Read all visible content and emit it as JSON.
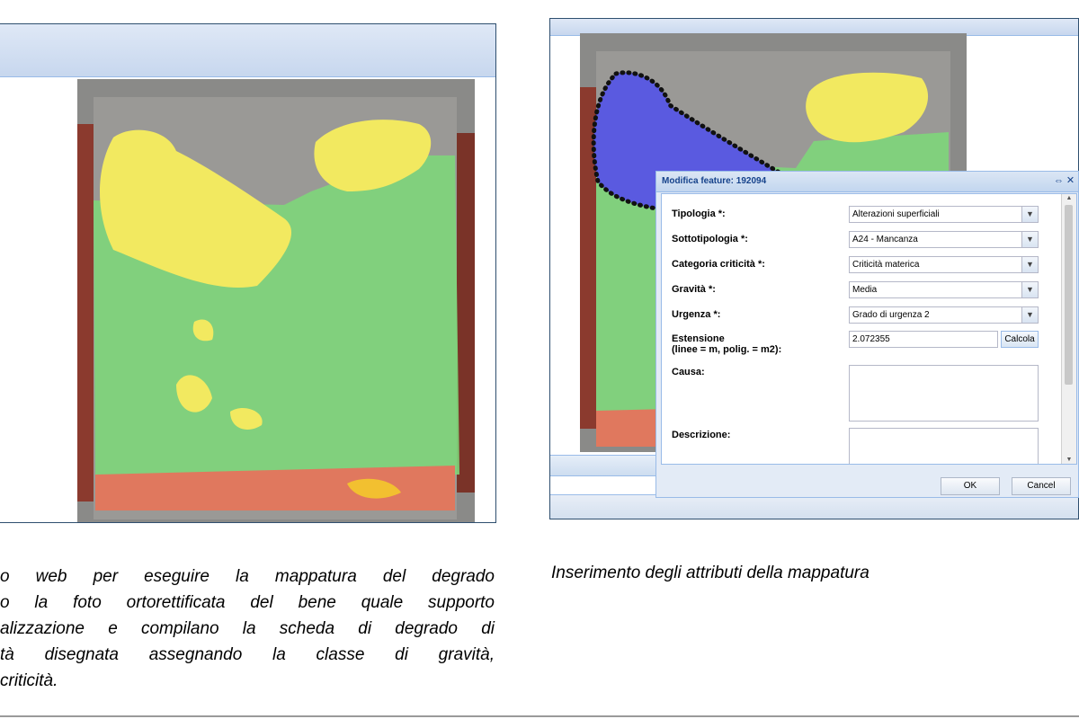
{
  "dialog": {
    "title": "Modifica feature: 192094",
    "tools": {
      "pin": "⇔",
      "close": "✕"
    },
    "fields": {
      "tipologia": {
        "label": "Tipologia *:",
        "value": "Alterazioni superficiali"
      },
      "sottotipologia": {
        "label": "Sottotipologia *:",
        "value": "A24 - Mancanza"
      },
      "categoria": {
        "label": "Categoria criticità *:",
        "value": "Criticità materica"
      },
      "gravita": {
        "label": "Gravità *:",
        "value": "Media"
      },
      "urgenza": {
        "label": "Urgenza *:",
        "value": "Grado di urgenza 2"
      },
      "estensione": {
        "label_line1": "Estensione",
        "label_line2": "(linee = m, polig. = m2):",
        "value": "2.072355",
        "calc_label": "Calcola"
      },
      "causa": {
        "label": "Causa:",
        "value": ""
      },
      "descrizione": {
        "label": "Descrizione:",
        "value": ""
      }
    },
    "ok_label": "OK",
    "cancel_label": "Cancel"
  },
  "captions": {
    "left_lines": [
      "o web per eseguire la mappatura del degrado",
      "o la foto ortorettificata del bene quale supporto",
      "alizzazione e compilano la scheda di degrado di",
      "tà disegnata assegnando la classe di gravità,",
      " criticità."
    ],
    "right": "Inserimento degli attributi della mappatura"
  },
  "colors": {
    "panel_border": "#2f4f6f",
    "dialog_header": "#c2d6ef",
    "overlay_green": "#7ed67a",
    "overlay_yellow": "#f2e960",
    "overlay_salmon": "#e0785e",
    "overlay_blue": "#5a5ae0"
  }
}
